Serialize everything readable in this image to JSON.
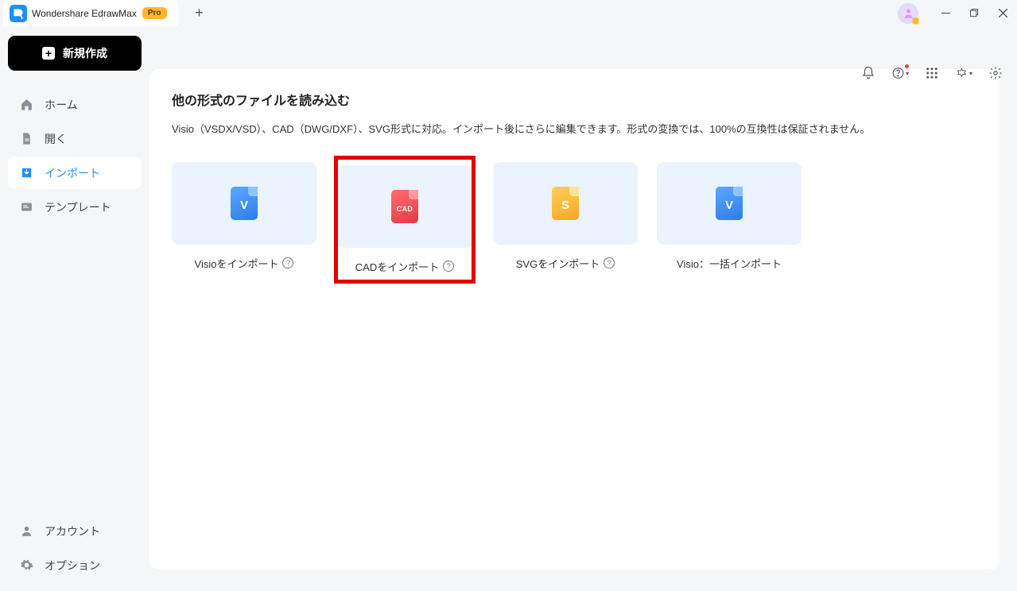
{
  "titlebar": {
    "app_name": "Wondershare EdrawMax",
    "pro_badge": "Pro"
  },
  "sidebar": {
    "new_button": "新規作成",
    "items": [
      {
        "label": "ホーム"
      },
      {
        "label": "開く"
      },
      {
        "label": "インポート"
      },
      {
        "label": "テンプレート"
      }
    ],
    "bottom": [
      {
        "label": "アカウント"
      },
      {
        "label": "オプション"
      }
    ]
  },
  "panel": {
    "title": "他の形式のファイルを読み込む",
    "description": "Visio（VSDX/VSD）、CAD（DWG/DXF）、SVG形式に対応。インポート後にさらに編集できます。形式の変換では、100%の互換性は保証されません。",
    "cards": [
      {
        "label": "Visioをインポート",
        "has_help": true
      },
      {
        "label": "CADをインポート",
        "has_help": true,
        "highlight": true
      },
      {
        "label": "SVGをインポート",
        "has_help": true
      },
      {
        "label": "Visio：一括インポート",
        "has_help": false
      }
    ]
  },
  "icons": {
    "visio_letter": "V",
    "cad_text": "CAD",
    "svg_letter": "S"
  }
}
